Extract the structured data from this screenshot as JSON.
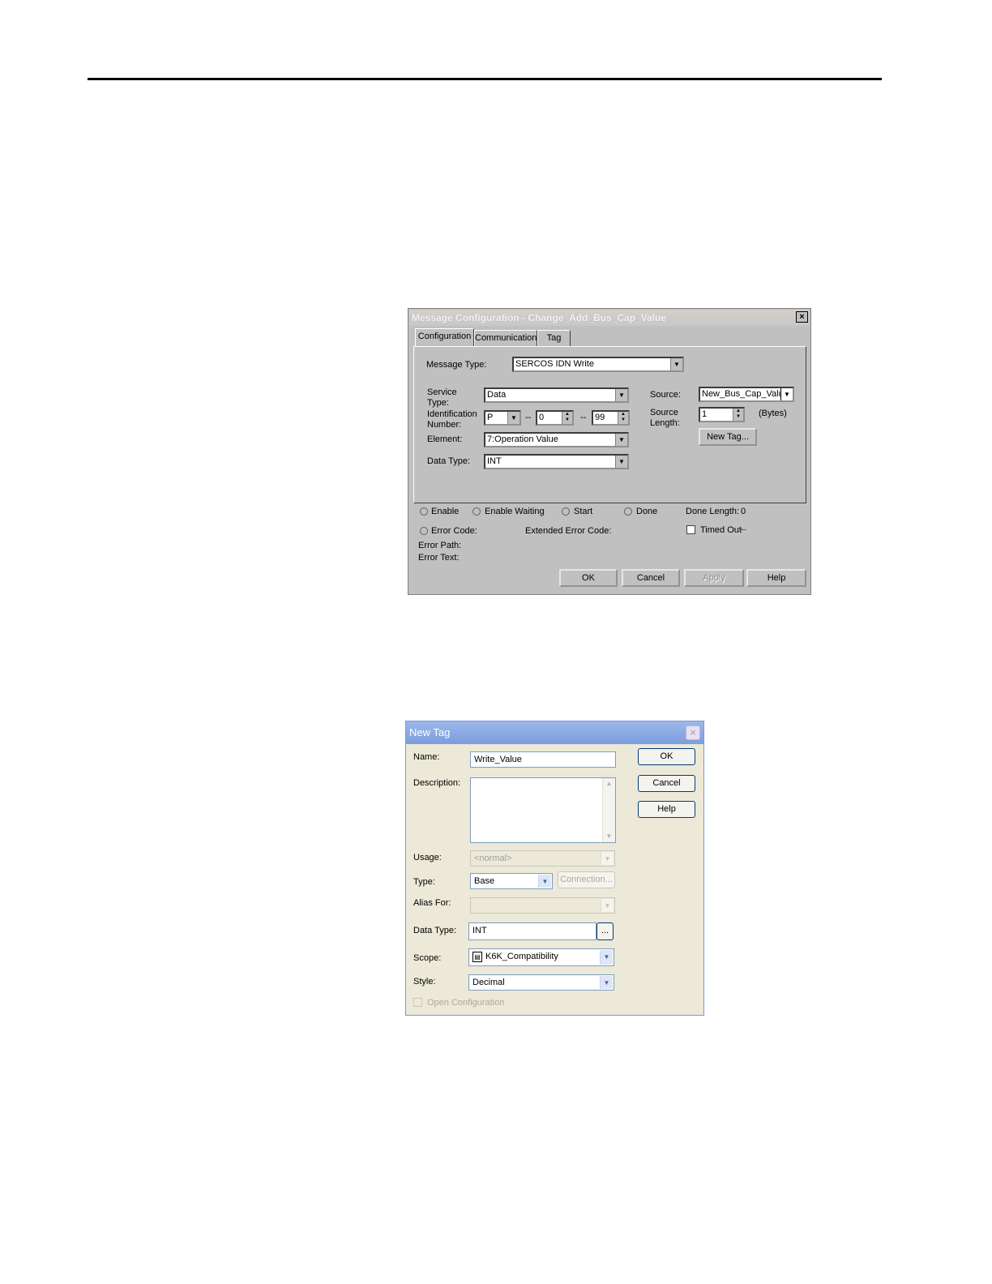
{
  "msg_dialog": {
    "title": "Message Configuration - Change_Add_Bus_Cap_Value",
    "close": "×",
    "tabs": [
      "Configuration",
      "Communication",
      "Tag"
    ],
    "message_type_label": "Message Type:",
    "message_type_value": "SERCOS IDN Write",
    "service_type_label1": "Service",
    "service_type_label2": "Type:",
    "service_type_value": "Data",
    "ident_label1": "Identification",
    "ident_label2": "Number:",
    "ident_set": "P",
    "ident_sep": "--",
    "ident_block": "0",
    "ident_number": "99",
    "element_label": "Element:",
    "element_value": "7:Operation Value",
    "data_type_label": "Data Type:",
    "data_type_value": "INT",
    "source_label": "Source:",
    "source_value": "New_Bus_Cap_Value",
    "source_length_label1": "Source",
    "source_length_label2": "Length:",
    "source_length_value": "1",
    "bytes_label": "(Bytes)",
    "new_tag_button": "New Tag...",
    "status": {
      "enable": "Enable",
      "enable_waiting": "Enable Waiting",
      "start": "Start",
      "done": "Done",
      "done_length_label": "Done Length:",
      "done_length_value": "0",
      "error_code": "Error Code:",
      "extended_error_code": "Extended Error Code:",
      "timed_out": "Timed Out",
      "error_path": "Error Path:",
      "error_text": "Error Text:"
    },
    "buttons": {
      "ok": "OK",
      "cancel": "Cancel",
      "apply": "Apply",
      "help": "Help"
    }
  },
  "tag_dialog": {
    "title": "New Tag",
    "close": "×",
    "name_label": "Name:",
    "name_value": "Write_Value",
    "description_label": "Description:",
    "usage_label": "Usage:",
    "usage_value": "<normal>",
    "type_label": "Type:",
    "type_value": "Base",
    "connection_button": "Connection...",
    "alias_label": "Alias For:",
    "data_type_label": "Data Type:",
    "data_type_value": "INT",
    "browse_button": "...",
    "scope_label": "Scope:",
    "scope_value": "K6K_Compatibility",
    "style_label": "Style:",
    "style_value": "Decimal",
    "open_config_label": "Open Configuration",
    "buttons": {
      "ok": "OK",
      "cancel": "Cancel",
      "help": "Help"
    }
  }
}
